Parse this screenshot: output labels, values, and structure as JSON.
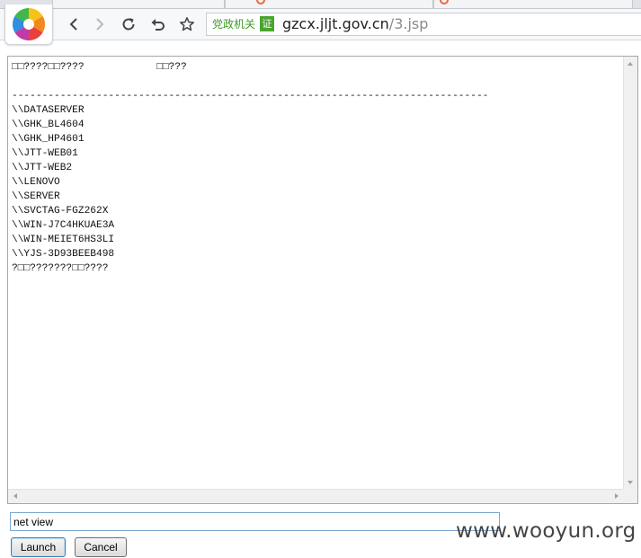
{
  "browser": {
    "address": {
      "badge_label": "党政机关",
      "cert_label": "证",
      "host": "gzcx.jljt.gov.cn",
      "path": "/3.jsp"
    }
  },
  "output": {
    "lines": [
      "□□????□□????            □□???",
      "",
      "-------------------------------------------------------------------------------",
      "\\\\DATASERVER",
      "\\\\GHK_BL4604",
      "\\\\GHK_HP4601",
      "\\\\JTT-WEB01",
      "\\\\JTT-WEB2",
      "\\\\LENOVO",
      "\\\\SERVER",
      "\\\\SVCTAG-FGZ262X",
      "\\\\WIN-J7C4HKUAE3A",
      "\\\\WIN-MEIET6HS3LI",
      "\\\\YJS-3D93BEEB498",
      "?□□???????□□????"
    ]
  },
  "command": {
    "value": "net view"
  },
  "buttons": {
    "launch": "Launch",
    "cancel": "Cancel"
  },
  "watermark": "www.wooyun.org",
  "colors": {
    "gov_green": "#3f9a24",
    "input_border": "#7aa7cf"
  }
}
